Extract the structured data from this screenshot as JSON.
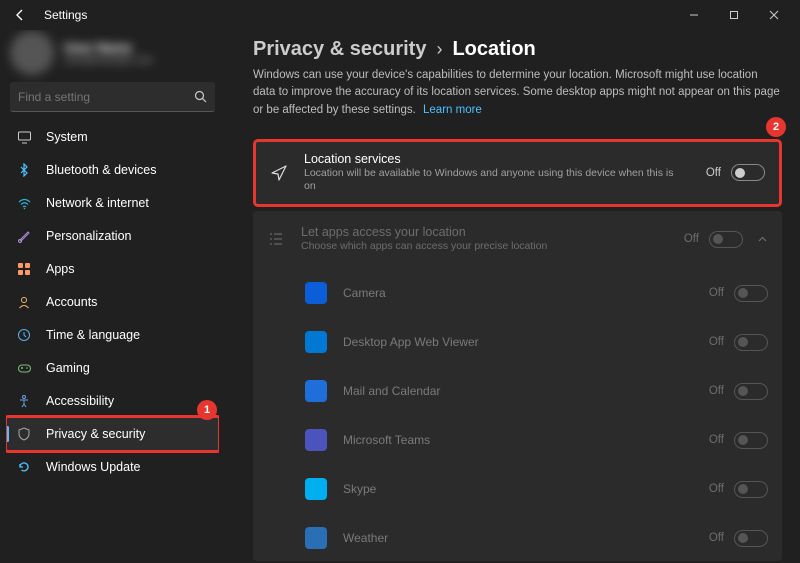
{
  "titlebar": {
    "title": "Settings"
  },
  "search": {
    "placeholder": "Find a setting"
  },
  "sidebar": {
    "items": [
      {
        "label": "System",
        "icon": "monitor",
        "color": "#ccc"
      },
      {
        "label": "Bluetooth & devices",
        "icon": "bluetooth",
        "color": "#4cc2ff"
      },
      {
        "label": "Network & internet",
        "icon": "wifi",
        "color": "#2fb0d4"
      },
      {
        "label": "Personalization",
        "icon": "brush",
        "color": "#b08cd8"
      },
      {
        "label": "Apps",
        "icon": "apps",
        "color": "#ff9a68"
      },
      {
        "label": "Accounts",
        "icon": "accounts",
        "color": "#f0b86c"
      },
      {
        "label": "Time & language",
        "icon": "clock",
        "color": "#5bb0e8"
      },
      {
        "label": "Gaming",
        "icon": "gaming",
        "color": "#78c078"
      },
      {
        "label": "Accessibility",
        "icon": "access",
        "color": "#6aa0e8"
      },
      {
        "label": "Privacy & security",
        "icon": "shield",
        "color": "#a8a8a8",
        "active": true
      },
      {
        "label": "Windows Update",
        "icon": "update",
        "color": "#4cc2ff"
      }
    ]
  },
  "badges": {
    "sidebar": "1",
    "main": "2"
  },
  "breadcrumb": {
    "parent": "Privacy & security",
    "sep": "›",
    "current": "Location"
  },
  "description": {
    "text": "Windows can use your device's capabilities to determine your location. Microsoft might use location data to improve the accuracy of its location services. Some desktop apps might not appear on this page or be affected by these settings.",
    "link": "Learn more"
  },
  "location_card": {
    "title": "Location services",
    "sub": "Location will be available to Windows and anyone using this device when this is on",
    "state": "Off"
  },
  "apps_card": {
    "title": "Let apps access your location",
    "sub": "Choose which apps can access your precise location",
    "state": "Off",
    "apps": [
      {
        "name": "Camera",
        "state": "Off",
        "bg": "#0b5ed7"
      },
      {
        "name": "Desktop App Web Viewer",
        "state": "Off",
        "bg": "#0078d4"
      },
      {
        "name": "Mail and Calendar",
        "state": "Off",
        "bg": "#1e6fd9"
      },
      {
        "name": "Microsoft Teams",
        "state": "Off",
        "bg": "#4b53bc"
      },
      {
        "name": "Skype",
        "state": "Off",
        "bg": "#00aff0"
      },
      {
        "name": "Weather",
        "state": "Off",
        "bg": "#2a6fb5"
      }
    ]
  }
}
